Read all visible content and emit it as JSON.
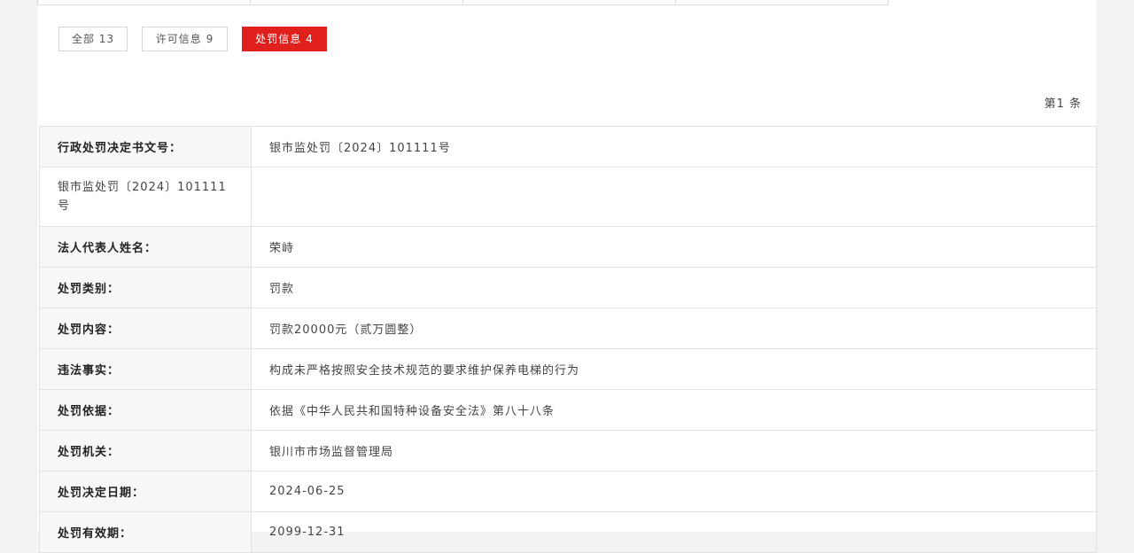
{
  "tabs": [
    {
      "label": "全部 13",
      "active": false
    },
    {
      "label": "许可信息 9",
      "active": false
    },
    {
      "label": "处罚信息 4",
      "active": true
    }
  ],
  "record_count": "第1 条",
  "accent_color": "#e0201c",
  "rows": [
    {
      "label": "行政处罚决定书文号：",
      "value": "银市监处罚〔2024〕101111号"
    },
    {
      "label": "银市监处罚〔2024〕101111号",
      "value": ""
    },
    {
      "label": "法人代表人姓名：",
      "value": "荣峙"
    },
    {
      "label": "处罚类别：",
      "value": "罚款"
    },
    {
      "label": "处罚内容：",
      "value": "罚款20000元（贰万圆整）"
    },
    {
      "label": "违法事实：",
      "value": "构成未严格按照安全技术规范的要求维护保养电梯的行为"
    },
    {
      "label": "处罚依据：",
      "value": "依据《中华人民共和国特种设备安全法》第八十八条"
    },
    {
      "label": "处罚机关：",
      "value": "银川市市场监督管理局"
    },
    {
      "label": "处罚决定日期：",
      "value": "2024-06-25"
    },
    {
      "label": "处罚有效期：",
      "value": "2099-12-31"
    }
  ]
}
